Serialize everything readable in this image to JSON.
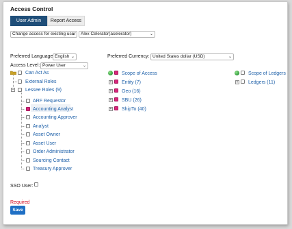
{
  "page": {
    "title": "Access Control"
  },
  "tabs": {
    "user_admin": "User Admin",
    "report_access": "Report Access"
  },
  "selectors": {
    "mode": "Change access for existing user",
    "user": "Alex Celerator(acelerator)"
  },
  "preferences": {
    "language_label": "Preferred Language:",
    "language_value": "English",
    "currency_label": "Preferred Currency:",
    "currency_value": "United States dollar (USD)",
    "access_level_label": "Access Level:",
    "access_level_value": "Power User"
  },
  "roles_tree": {
    "root": "Can Act As",
    "external": "External Roles",
    "lessee": "Lessee Roles (9)",
    "children": [
      {
        "label": "ARF Requestor",
        "checked": false
      },
      {
        "label": "Accounting Analyst",
        "checked": true
      },
      {
        "label": "Accounting Approver",
        "checked": false
      },
      {
        "label": "Analyst",
        "checked": false
      },
      {
        "label": "Asset Owner",
        "checked": false
      },
      {
        "label": "Asset User",
        "checked": false
      },
      {
        "label": "Order Administrator",
        "checked": false
      },
      {
        "label": "Sourcing Contact",
        "checked": false
      },
      {
        "label": "Treasury Approver",
        "checked": false
      }
    ]
  },
  "scope_tree": {
    "root": "Scope of Access",
    "items": [
      "Entity (7)",
      "Geo (16)",
      "SBU (26)",
      "ShipTo (40)"
    ]
  },
  "ledger_tree": {
    "root": "Scope of Ledgers",
    "items": [
      "Ledgers (11)"
    ]
  },
  "sso": {
    "label": "SSO User:"
  },
  "footer": {
    "required": "Required",
    "save": "Save"
  },
  "colors": {
    "primary": "#1f4e79",
    "link": "#1c5fa8",
    "save": "#1f6fc5",
    "required": "#d0021b",
    "checked": "#d8267a"
  }
}
